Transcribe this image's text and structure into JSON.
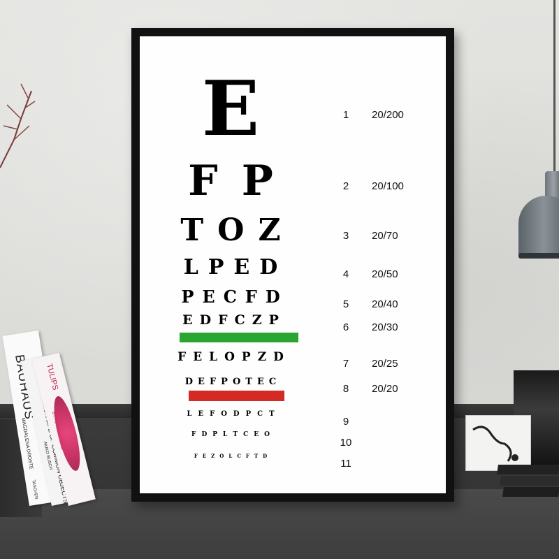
{
  "chart": {
    "rows": [
      {
        "letters": [
          "E"
        ],
        "line": "1",
        "acuity": "20/200"
      },
      {
        "letters": [
          "F",
          "P"
        ],
        "line": "2",
        "acuity": "20/100"
      },
      {
        "letters": [
          "T",
          "O",
          "Z"
        ],
        "line": "3",
        "acuity": "20/70"
      },
      {
        "letters": [
          "L",
          "P",
          "E",
          "D"
        ],
        "line": "4",
        "acuity": "20/50"
      },
      {
        "letters": [
          "P",
          "E",
          "C",
          "F",
          "D"
        ],
        "line": "5",
        "acuity": "20/40"
      },
      {
        "letters": [
          "E",
          "D",
          "F",
          "C",
          "Z",
          "P"
        ],
        "line": "6",
        "acuity": "20/30"
      },
      {
        "letters": [
          "F",
          "E",
          "L",
          "O",
          "P",
          "Z",
          "D"
        ],
        "line": "7",
        "acuity": "20/25"
      },
      {
        "letters": [
          "D",
          "E",
          "F",
          "P",
          "O",
          "T",
          "E",
          "C"
        ],
        "line": "8",
        "acuity": "20/20"
      },
      {
        "letters": [
          "L",
          "E",
          "F",
          "O",
          "D",
          "P",
          "C",
          "T"
        ],
        "line": "9",
        "acuity": ""
      },
      {
        "letters": [
          "F",
          "D",
          "P",
          "L",
          "T",
          "C",
          "E",
          "O"
        ],
        "line": "10",
        "acuity": ""
      },
      {
        "letters": [
          "F",
          "E",
          "Z",
          "O",
          "L",
          "C",
          "F",
          "T",
          "D"
        ],
        "line": "11",
        "acuity": ""
      }
    ],
    "markers": {
      "green": "#2aa52f",
      "red": "#d42a24"
    }
  },
  "books": {
    "book1_title": "BAUHAUS",
    "book1_sub": "MAGDALENA DROSTE",
    "book1_pub": "TASCHEN",
    "book2_title": "THE UNCOMMON LIFE OF COMMON OBJECTS",
    "book2_sub": "AKIKO BUSCH",
    "book3_title": "TULIPS",
    "book3_sub": "BY PETER ARNOLD"
  },
  "colors": {
    "frame": "#111111",
    "wall": "#dcdcd9",
    "shelf": "#3a3a3a"
  }
}
